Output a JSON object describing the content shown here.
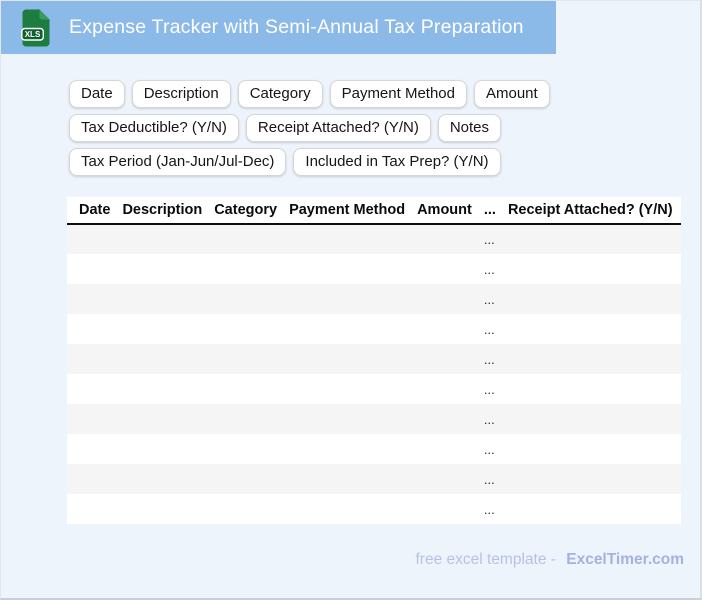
{
  "header": {
    "title": "Expense Tracker with Semi-Annual Tax Preparation",
    "file_badge": "XLS",
    "background_color": "#8cbae8",
    "icon_green": "#1d7c40",
    "icon_green_dark": "#10602f"
  },
  "chips": {
    "items": [
      "Date",
      "Description",
      "Category",
      "Payment Method",
      "Amount",
      "Tax Deductible? (Y/N)",
      "Receipt Attached? (Y/N)",
      "Notes",
      "Tax Period (Jan-Jun/Jul-Dec)",
      "Included in Tax Prep? (Y/N)"
    ]
  },
  "table": {
    "columns": [
      "Date",
      "Description",
      "Category",
      "Payment Method",
      "Amount",
      "...",
      "Receipt Attached? (Y/N)"
    ],
    "row_count": 10,
    "row_placeholder": "...",
    "placeholder_column_index": 5,
    "stripe_color": "#f5f5f5"
  },
  "footer": {
    "note": "free excel template -",
    "brand": "ExcelTimer.com"
  }
}
